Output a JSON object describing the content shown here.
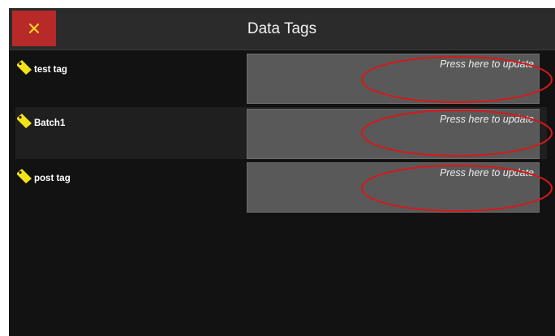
{
  "header": {
    "title": "Data Tags",
    "close_glyph": "✕"
  },
  "tags": [
    {
      "name": "test tag",
      "action": "Press here to update"
    },
    {
      "name": "Batch1",
      "action": "Press here to update"
    },
    {
      "name": "post tag",
      "action": "Press here to update"
    }
  ],
  "colors": {
    "close_button": "#b82a2a",
    "tag_icon": "#f2e21a",
    "annotation": "#d81818"
  },
  "icons": {
    "close": "close-icon",
    "tag": "tag-icon"
  }
}
